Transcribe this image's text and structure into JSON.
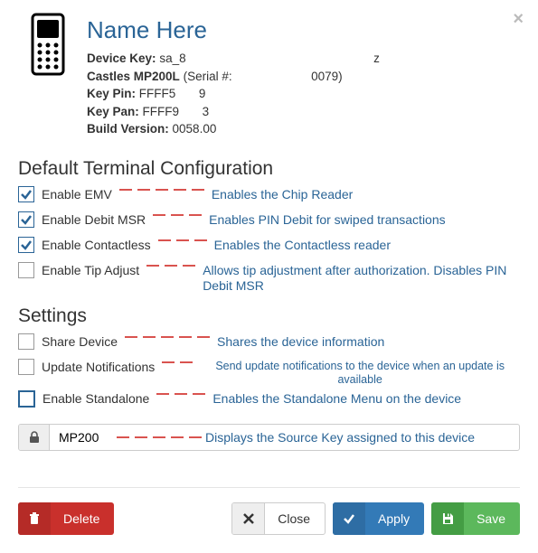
{
  "header": {
    "title": "Name Here",
    "device_key_label": "Device Key:",
    "device_key_value": "sa_8",
    "device_key_value_tail": "z",
    "model_label": "Castles MP200L",
    "serial_label": "(Serial #:",
    "serial_value": "0079)",
    "key_pin_label": "Key Pin:",
    "key_pin_value1": "FFFF5",
    "key_pin_value2": "9",
    "key_pan_label": "Key Pan:",
    "key_pan_value1": "FFFF9",
    "key_pan_value2": "3",
    "build_label": "Build Version:",
    "build_value": "0058.00"
  },
  "section_terminal": "Default Terminal Configuration",
  "opts": {
    "emv": {
      "label": "Enable EMV",
      "desc": "Enables the Chip Reader",
      "checked": true
    },
    "debit": {
      "label": "Enable Debit MSR",
      "desc": "Enables PIN Debit for swiped transactions",
      "checked": true
    },
    "contactless": {
      "label": "Enable Contactless",
      "desc": "Enables the Contactless reader",
      "checked": true
    },
    "tip": {
      "label": "Enable Tip Adjust",
      "desc": "Allows tip adjustment after authorization. Disables PIN Debit MSR",
      "checked": false
    }
  },
  "section_settings": "Settings",
  "settings": {
    "share": {
      "label": "Share Device",
      "desc": "Shares the device information",
      "checked": false
    },
    "update": {
      "label": "Update Notifications",
      "desc": "Send update notifications to the device when an update is available",
      "checked": false
    },
    "standalone": {
      "label": "Enable Standalone",
      "desc": "Enables the Standalone Menu on the device",
      "checked": false
    }
  },
  "source": {
    "value": "MP200",
    "desc": "Displays the Source Key assigned to this device"
  },
  "buttons": {
    "delete": "Delete",
    "close": "Close",
    "apply": "Apply",
    "save": "Save"
  }
}
